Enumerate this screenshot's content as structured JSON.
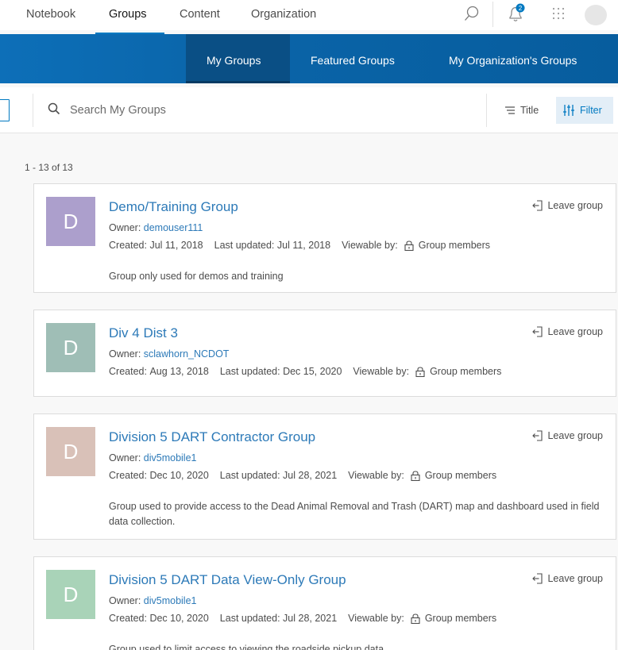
{
  "topnav": {
    "items": [
      {
        "label": "Notebook"
      },
      {
        "label": "Groups"
      },
      {
        "label": "Content"
      },
      {
        "label": "Organization"
      }
    ],
    "active_index": 1,
    "notification_count": "2",
    "icons": [
      "search-icon",
      "bell-icon",
      "apps-grid-icon",
      "avatar"
    ]
  },
  "groupnav": {
    "tabs": [
      {
        "label": "My Groups"
      },
      {
        "label": "Featured Groups"
      },
      {
        "label": "My Organization's Groups"
      }
    ],
    "active_index": 0
  },
  "search": {
    "placeholder": "Search My Groups",
    "value": "",
    "sort_label": "Title",
    "filter_label": "Filter"
  },
  "results": {
    "count_label": "1 - 13 of 13"
  },
  "groups": [
    {
      "initial": "D",
      "color": "#ac9fcc",
      "title": "Demo/Training Group",
      "owner_label": "Owner:",
      "owner": "demouser111",
      "created_label": "Created:",
      "created": "Jul 11, 2018",
      "updated_label": "Last updated:",
      "updated": "Jul 11, 2018",
      "viewable_label": "Viewable by:",
      "viewable": "Group members",
      "description": "Group only used for demos and training",
      "leave_label": "Leave group"
    },
    {
      "initial": "D",
      "color": "#9fbeb6",
      "title": "Div 4 Dist 3",
      "owner_label": "Owner:",
      "owner": "sclawhorn_NCDOT",
      "created_label": "Created:",
      "created": "Aug 13, 2018",
      "updated_label": "Last updated:",
      "updated": "Dec 15, 2020",
      "viewable_label": "Viewable by:",
      "viewable": "Group members",
      "description": "",
      "leave_label": "Leave group"
    },
    {
      "initial": "D",
      "color": "#d9c1b8",
      "title": "Division 5 DART Contractor Group",
      "owner_label": "Owner:",
      "owner": "div5mobile1",
      "created_label": "Created:",
      "created": "Dec 10, 2020",
      "updated_label": "Last updated:",
      "updated": "Jul 28, 2021",
      "viewable_label": "Viewable by:",
      "viewable": "Group members",
      "description": "Group used to provide access to the Dead Animal Removal and Trash (DART) map and dashboard used in field data collection.",
      "leave_label": "Leave group"
    },
    {
      "initial": "D",
      "color": "#a9d3b8",
      "title": "Division 5 DART Data View-Only Group",
      "owner_label": "Owner:",
      "owner": "div5mobile1",
      "created_label": "Created:",
      "created": "Dec 10, 2020",
      "updated_label": "Last updated:",
      "updated": "Jul 28, 2021",
      "viewable_label": "Viewable by:",
      "viewable": "Group members",
      "description": "Group used to limit access to viewing the roadside pickup data.",
      "leave_label": "Leave group"
    }
  ]
}
